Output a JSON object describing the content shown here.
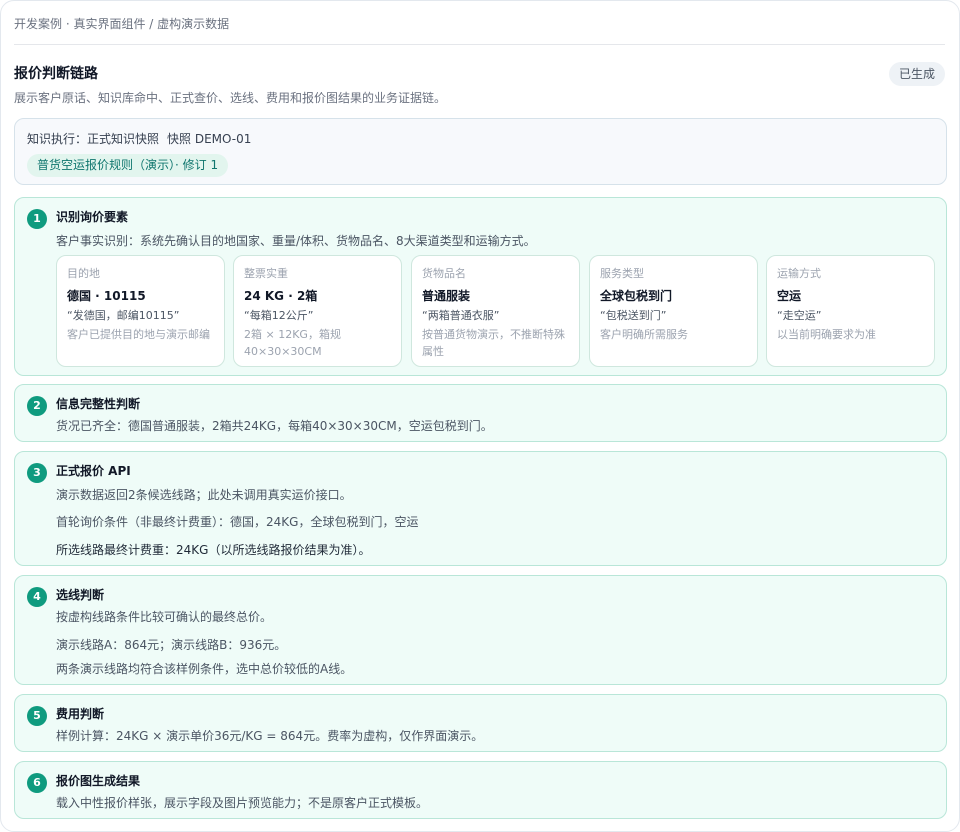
{
  "breadcrumb": "开发案例 · 真实界面组件 / 虚构演示数据",
  "page": {
    "title": "报价判断链路",
    "subtitle": "展示客户原话、知识库命中、正式查价、选线、费用和报价图结果的业务证据链。",
    "status": "已生成"
  },
  "knowledge": {
    "label": "知识执行：",
    "mode": "正式知识快照",
    "snapshot": "快照 DEMO-01",
    "rule_chip": "普货空运报价规则（演示）· 修订 1"
  },
  "steps": [
    {
      "num": "1",
      "title": "识别询价要素",
      "lines": [
        "客户事实识别：系统先确认目的地国家、重量/体积、货物品名、8大渠道类型和运输方式。"
      ],
      "cards": [
        {
          "label": "目的地",
          "value": "德国 · 10115",
          "quote": "“发德国，邮编10115”",
          "note": "客户已提供目的地与演示邮编"
        },
        {
          "label": "整票实重",
          "value": "24 KG · 2箱",
          "quote": "“每箱12公斤”",
          "note": "2箱 × 12KG，箱规 40×30×30CM"
        },
        {
          "label": "货物品名",
          "value": "普通服装",
          "quote": "“两箱普通衣服”",
          "note": "按普通货物演示，不推断特殊属性"
        },
        {
          "label": "服务类型",
          "value": "全球包税到门",
          "quote": "“包税送到门”",
          "note": "客户明确所需服务"
        },
        {
          "label": "运输方式",
          "value": "空运",
          "quote": "“走空运”",
          "note": "以当前明确要求为准"
        }
      ]
    },
    {
      "num": "2",
      "title": "信息完整性判断",
      "lines": [
        "货况已齐全：德国普通服装，2箱共24KG，每箱40×30×30CM，空运包税到门。"
      ]
    },
    {
      "num": "3",
      "title": "正式报价 API",
      "lines": [
        "演示数据返回2条候选线路；此处未调用真实运价接口。",
        "首轮询价条件（非最终计费重）：德国，24KG，全球包税到门，空运",
        "所选线路最终计费重：24KG（以所选线路报价结果为准）。"
      ]
    },
    {
      "num": "4",
      "title": "选线判断",
      "lines": [
        "按虚构线路条件比较可确认的最终总价。",
        "演示线路A：864元；演示线路B：936元。",
        "两条演示线路均符合该样例条件，选中总价较低的A线。"
      ]
    },
    {
      "num": "5",
      "title": "费用判断",
      "lines": [
        "样例计算：24KG × 演示单价36元/KG = 864元。费率为虚构，仅作界面演示。"
      ]
    },
    {
      "num": "6",
      "title": "报价图生成结果",
      "lines": [
        "载入中性报价样张，展示字段及图片预览能力；不是原客户正式模板。"
      ]
    }
  ]
}
